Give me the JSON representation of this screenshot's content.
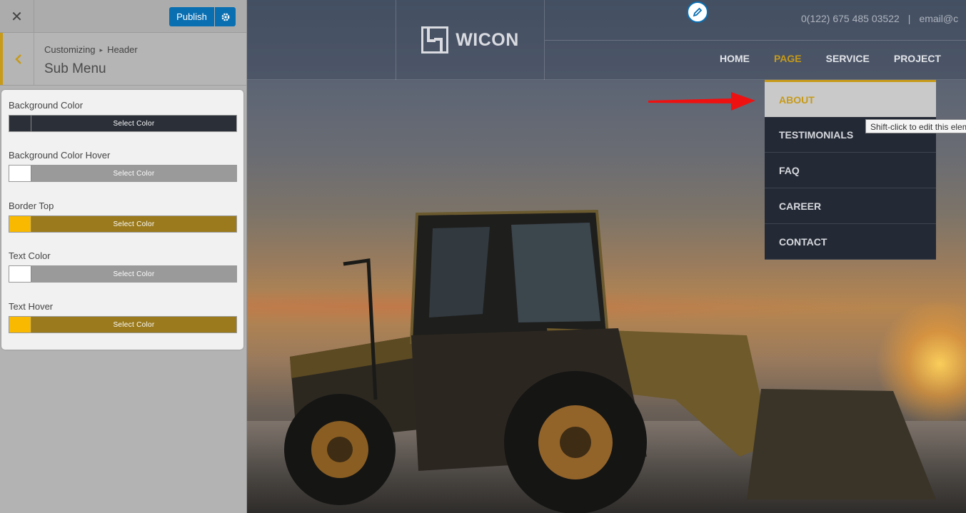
{
  "sidebar": {
    "close_icon": "close-icon",
    "publish_label": "Publish",
    "gear_icon": "gear-icon",
    "back_icon": "chevron-left-icon",
    "breadcrumb": {
      "root": "Customizing",
      "separator": "▸",
      "section": "Header"
    },
    "panel_title": "Sub Menu",
    "controls": [
      {
        "label": "Background Color",
        "button": "Select Color",
        "swatch": "#2a2f38",
        "bar": "#2a2f38"
      },
      {
        "label": "Background Color Hover",
        "button": "Select Color",
        "swatch": "#ffffff",
        "bar": "#9a9a9a"
      },
      {
        "label": "Border Top",
        "button": "Select Color",
        "swatch": "#f8b900",
        "bar": "#9a7a1c"
      },
      {
        "label": "Text Color",
        "button": "Select Color",
        "swatch": "#ffffff",
        "bar": "#9a9a9a"
      },
      {
        "label": "Text Hover",
        "button": "Select Color",
        "swatch": "#f8b900",
        "bar": "#9a7a1c"
      }
    ]
  },
  "preview": {
    "edit_icon": "pencil-icon",
    "logo_text": "WICON",
    "phone": "0(122) 675 485 03522",
    "contact_divider": "|",
    "email": "email@c",
    "nav": [
      {
        "label": "HOME",
        "active": false
      },
      {
        "label": "PAGE",
        "active": true
      },
      {
        "label": "SERVICE",
        "active": false
      },
      {
        "label": "PROJECT",
        "active": false
      }
    ],
    "submenu": [
      "ABOUT",
      "TESTIMONIALS",
      "FAQ",
      "CAREER",
      "CONTACT"
    ],
    "tooltip": "Shift-click to edit this element",
    "accent_color": "#c79a18",
    "submenu_bg": "#242a35"
  }
}
